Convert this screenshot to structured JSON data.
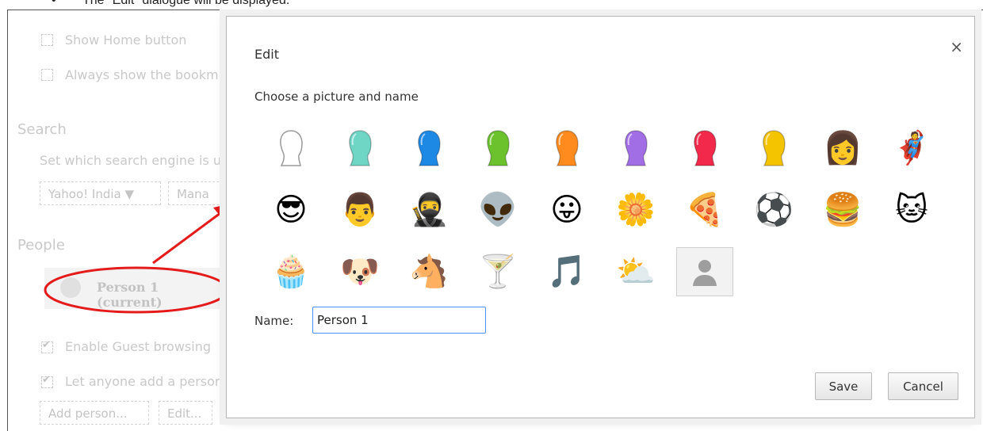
{
  "caption": {
    "bullet": "•",
    "text": "The \"Edit\" dialogue will be displayed."
  },
  "background_settings": {
    "show_home_button": "Show Home button",
    "always_show_bookmarks": "Always show the bookm",
    "search_heading": "Search",
    "search_desc": "Set which search engine is us",
    "search_engine": "Yahoo! India",
    "manage_button": "Mana",
    "people_heading": "People",
    "person_name": "Person 1 (current)",
    "enable_guest": "Enable Guest browsing",
    "let_anyone_add": "Let anyone add a person",
    "add_person_button": "Add person...",
    "edit_button": "Edit..."
  },
  "dialog": {
    "title": "Edit",
    "close": "×",
    "subtitle": "Choose a picture and name",
    "avatars": [
      {
        "kind": "silhouette",
        "color": "#ffffff"
      },
      {
        "kind": "silhouette",
        "color": "#6fd6c6"
      },
      {
        "kind": "silhouette",
        "color": "#1e88e5"
      },
      {
        "kind": "silhouette",
        "color": "#6cc22d"
      },
      {
        "kind": "silhouette",
        "color": "#ff8a1e"
      },
      {
        "kind": "silhouette",
        "color": "#a26ee6"
      },
      {
        "kind": "silhouette",
        "color": "#f2294a"
      },
      {
        "kind": "silhouette",
        "color": "#f5c400"
      },
      {
        "kind": "emoji",
        "icon": "businesswoman",
        "glyph": "👩"
      },
      {
        "kind": "emoji",
        "icon": "superhero",
        "glyph": "🦸"
      },
      {
        "kind": "emoji",
        "icon": "woman-sunglasses",
        "glyph": "😎"
      },
      {
        "kind": "emoji",
        "icon": "businessman",
        "glyph": "👨"
      },
      {
        "kind": "emoji",
        "icon": "ninja",
        "glyph": "🥷"
      },
      {
        "kind": "emoji",
        "icon": "alien",
        "glyph": "👽"
      },
      {
        "kind": "emoji",
        "icon": "awesome-face",
        "glyph": "😛"
      },
      {
        "kind": "emoji",
        "icon": "flower",
        "glyph": "🌼"
      },
      {
        "kind": "emoji",
        "icon": "pizza",
        "glyph": "🍕"
      },
      {
        "kind": "emoji",
        "icon": "soccer-ball",
        "glyph": "⚽"
      },
      {
        "kind": "emoji",
        "icon": "burger",
        "glyph": "🍔"
      },
      {
        "kind": "emoji",
        "icon": "cat",
        "glyph": "🐱"
      },
      {
        "kind": "emoji",
        "icon": "cupcake",
        "glyph": "🧁"
      },
      {
        "kind": "emoji",
        "icon": "dog",
        "glyph": "🐶"
      },
      {
        "kind": "emoji",
        "icon": "horse",
        "glyph": "🐴"
      },
      {
        "kind": "emoji",
        "icon": "cocktail",
        "glyph": "🍸"
      },
      {
        "kind": "emoji",
        "icon": "music-note",
        "glyph": "🎵"
      },
      {
        "kind": "emoji",
        "icon": "sun-cloud",
        "glyph": "⛅"
      },
      {
        "kind": "placeholder",
        "selected": true
      }
    ],
    "name_label": "Name:",
    "name_value": "Person 1",
    "save_label": "Save",
    "cancel_label": "Cancel"
  },
  "colors": {
    "annotation_red": "#e31b1b",
    "focus_blue": "#4d90fe"
  }
}
